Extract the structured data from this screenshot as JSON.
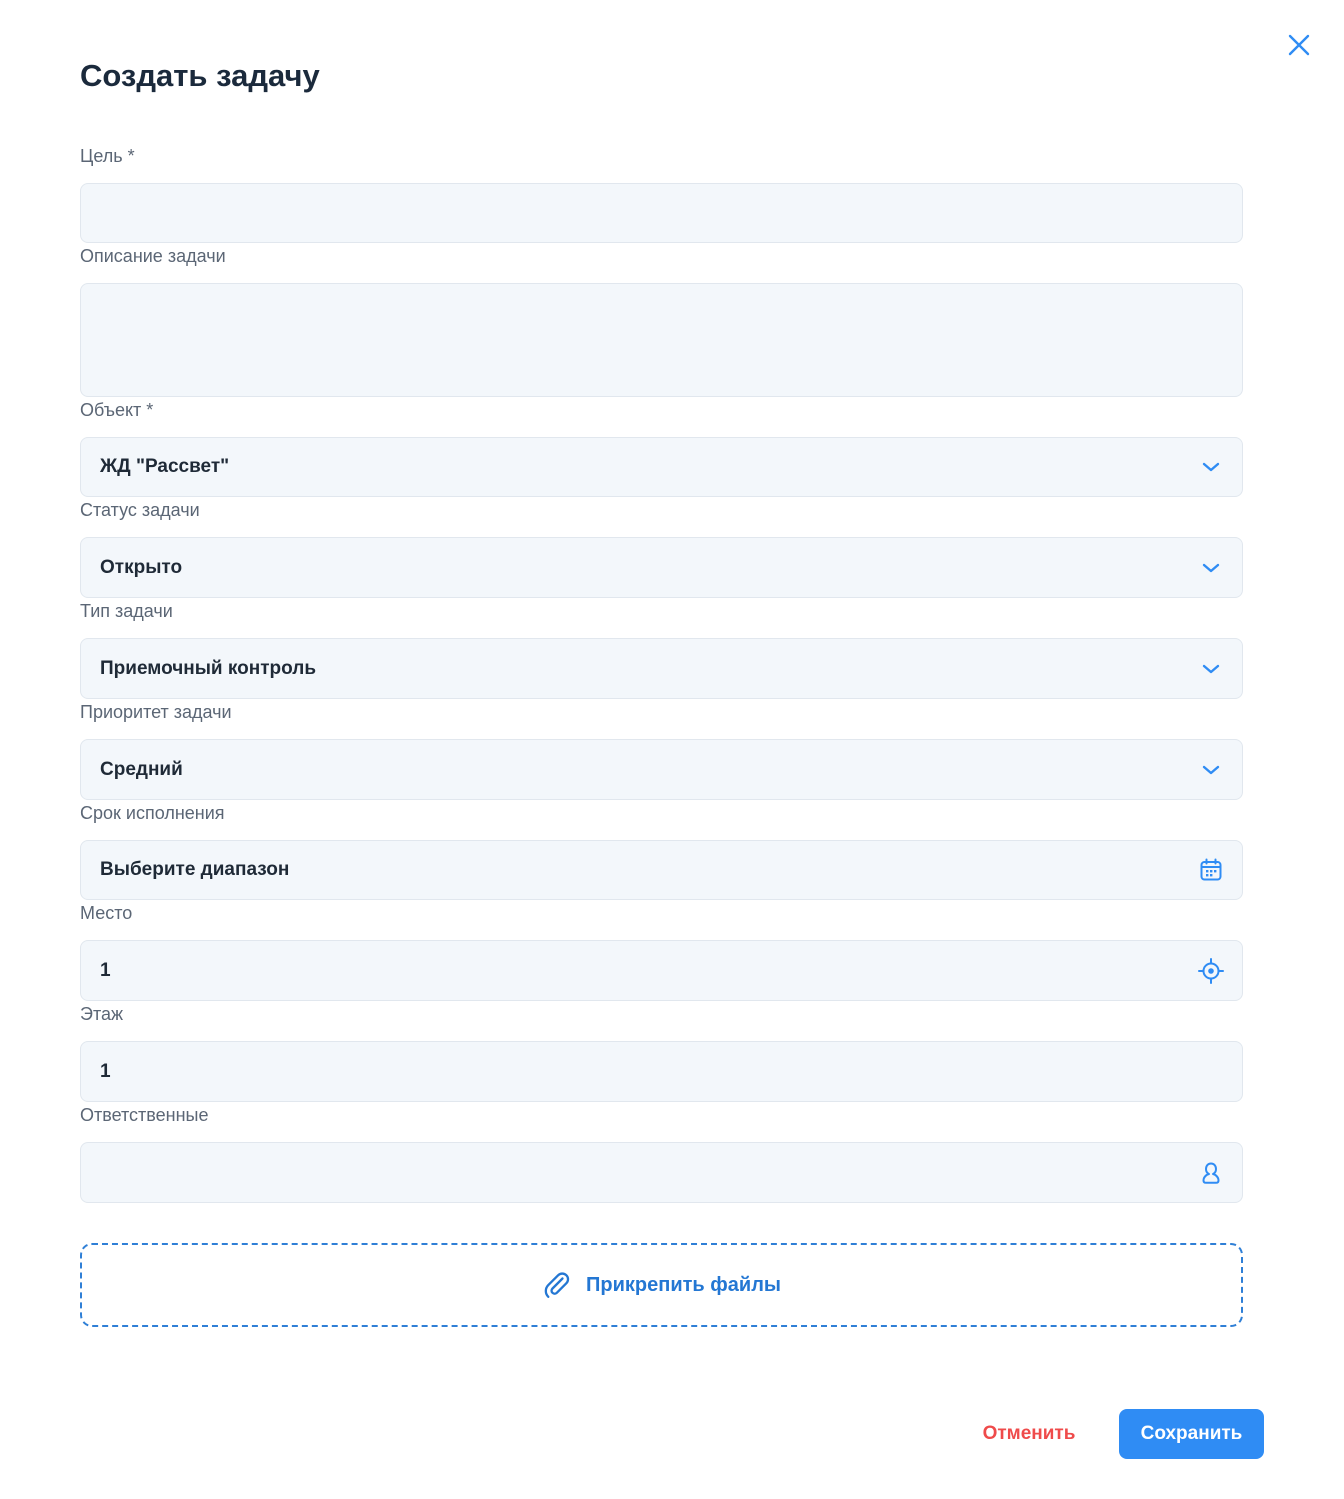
{
  "dialog": {
    "title": "Создать задачу",
    "close_icon": "close-icon"
  },
  "form": {
    "goal": {
      "label": "Цель *",
      "value": ""
    },
    "description": {
      "label": "Описание задачи",
      "value": ""
    },
    "object": {
      "label": "Объект *",
      "value": "ЖД \"Рассвет\"",
      "icon": "chevron-down-icon"
    },
    "status": {
      "label": "Статус задачи",
      "value": "Открыто",
      "icon": "chevron-down-icon"
    },
    "type": {
      "label": "Тип задачи",
      "value": "Приемочный контроль",
      "icon": "chevron-down-icon"
    },
    "priority": {
      "label": "Приоритет задачи",
      "value": "Средний",
      "icon": "chevron-down-icon"
    },
    "deadline": {
      "label": "Срок исполнения",
      "value": "Выберите диапазон",
      "icon": "calendar-icon"
    },
    "place": {
      "label": "Место",
      "value": "1",
      "icon": "crosshair-icon"
    },
    "floor": {
      "label": "Этаж",
      "value": "1"
    },
    "assignees": {
      "label": "Ответственные",
      "value": "",
      "icon": "user-icon"
    }
  },
  "attach": {
    "label": "Прикрепить файлы",
    "icon": "paperclip-icon"
  },
  "actions": {
    "cancel_label": "Отменить",
    "save_label": "Сохранить"
  },
  "colors": {
    "accent": "#2f8cf4",
    "accent_text": "#2477d3",
    "danger": "#ef4b4b",
    "field_bg": "#f3f7fb",
    "title": "#1b2a3c"
  }
}
